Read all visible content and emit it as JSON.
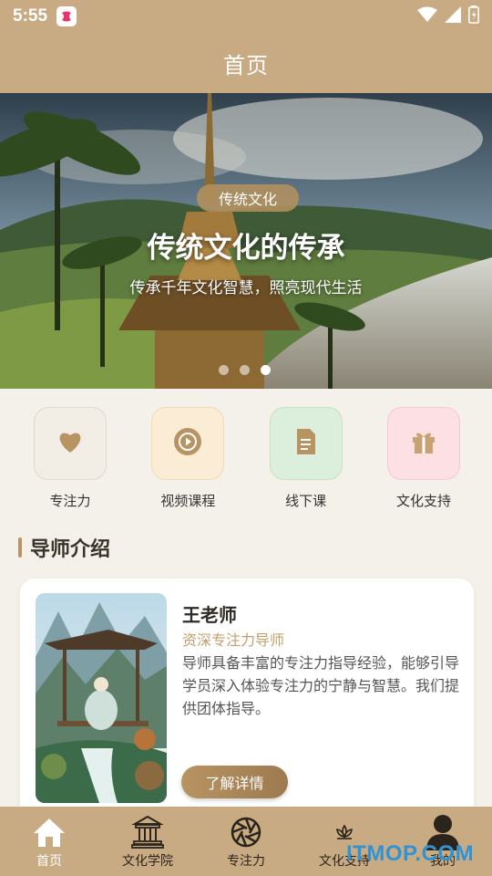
{
  "status_bar": {
    "time": "5:55"
  },
  "header": {
    "title": "首页"
  },
  "banner": {
    "tag": "传统文化",
    "title": "传统文化的传承",
    "subtitle": "传承千年文化智慧，照亮现代生活",
    "slide_count": 3,
    "active_slide": 3
  },
  "quick_links": [
    {
      "label": "专注力",
      "icon": "heart-icon"
    },
    {
      "label": "视频课程",
      "icon": "play-icon"
    },
    {
      "label": "线下课",
      "icon": "document-icon"
    },
    {
      "label": "文化支持",
      "icon": "gift-icon"
    }
  ],
  "section": {
    "title": "导师介绍"
  },
  "teacher": {
    "name": "王老师",
    "title": "资深专注力导师",
    "description": "导师具备丰富的专注力指导经验，能够引导学员深入体验专注力的宁静与智慧。我们提供团体指导。",
    "button_label": "了解详情"
  },
  "bottom_nav": [
    {
      "label": "首页",
      "icon": "home-icon",
      "active": true
    },
    {
      "label": "文化学院",
      "icon": "temple-icon",
      "active": false
    },
    {
      "label": "专注力",
      "icon": "aperture-icon",
      "active": false
    },
    {
      "label": "文化支持",
      "icon": "lotus-icon",
      "active": false
    },
    {
      "label": "我的",
      "icon": "profile-icon",
      "active": false
    }
  ],
  "watermark": "ITMOP.COM",
  "colors": {
    "brand": "#c8ab82",
    "accent": "#b59566",
    "subtitle": "#c2a06e"
  }
}
